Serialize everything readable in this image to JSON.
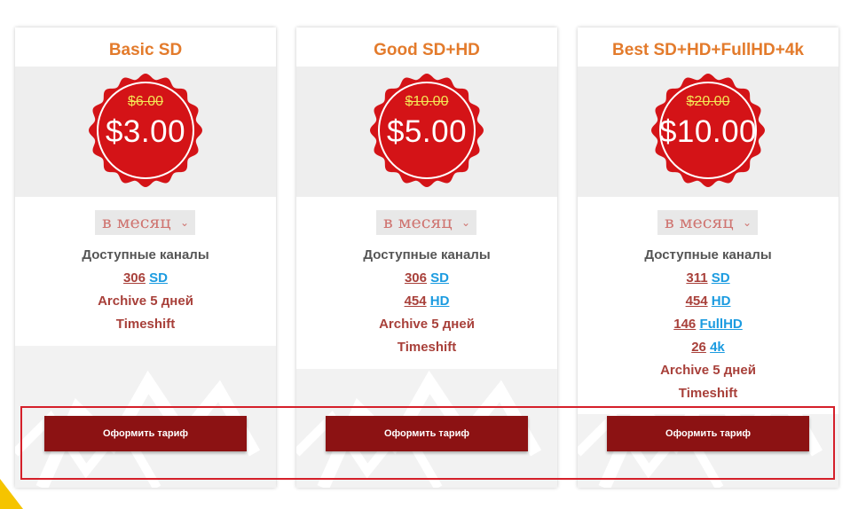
{
  "plans": [
    {
      "title": "Basic SD",
      "old_price": "$6.00",
      "price": "$3.00",
      "period": "в месяц",
      "features_heading": "Доступные каналы",
      "channels": [
        {
          "count": "306",
          "quality": "SD"
        }
      ],
      "archive": "Archive 5 дней",
      "timeshift": "Timeshift",
      "button": "Оформить тариф"
    },
    {
      "title": "Good SD+HD",
      "old_price": "$10.00",
      "price": "$5.00",
      "period": "в месяц",
      "features_heading": "Доступные каналы",
      "channels": [
        {
          "count": "306",
          "quality": "SD"
        },
        {
          "count": "454",
          "quality": "HD"
        }
      ],
      "archive": "Archive 5 дней",
      "timeshift": "Timeshift",
      "button": "Оформить тариф"
    },
    {
      "title": "Best SD+HD+FullHD+4k",
      "old_price": "$20.00",
      "price": "$10.00",
      "period": "в месяц",
      "features_heading": "Доступные каналы",
      "channels": [
        {
          "count": "311",
          "quality": "SD"
        },
        {
          "count": "454",
          "quality": "HD"
        },
        {
          "count": "146",
          "quality": "FullHD"
        },
        {
          "count": "26",
          "quality": "4k"
        }
      ],
      "archive": "Archive 5 дней",
      "timeshift": "Timeshift",
      "button": "Оформить тариф"
    }
  ],
  "icons": {
    "period_dropdown": "chevron-down-icon",
    "badge": "price-seal-icon"
  },
  "colors": {
    "title": "#e37b2c",
    "badge": "#d41317",
    "old_price": "#f3e455",
    "button": "#8c1213",
    "link": "#1b9be0",
    "text_red": "#a8403a",
    "highlight": "#d5202a"
  }
}
